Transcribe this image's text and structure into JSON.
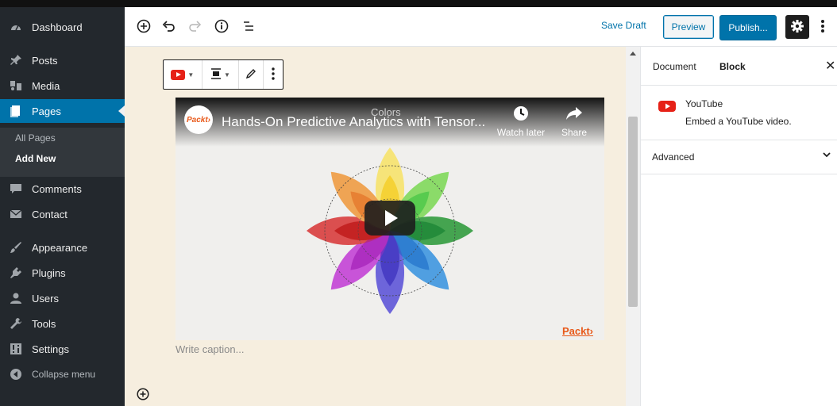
{
  "admin_menu": {
    "items": [
      {
        "label": "Dashboard",
        "icon": "dashboard-icon"
      },
      {
        "label": "Posts",
        "icon": "pin-icon"
      },
      {
        "label": "Media",
        "icon": "media-icon"
      },
      {
        "label": "Pages",
        "icon": "page-icon",
        "active": true
      },
      {
        "label": "Comments",
        "icon": "comment-icon"
      },
      {
        "label": "Contact",
        "icon": "mail-icon"
      },
      {
        "label": "Appearance",
        "icon": "brush-icon"
      },
      {
        "label": "Plugins",
        "icon": "plug-icon"
      },
      {
        "label": "Users",
        "icon": "users-icon"
      },
      {
        "label": "Tools",
        "icon": "wrench-icon"
      },
      {
        "label": "Settings",
        "icon": "settings-icon"
      }
    ],
    "submenu": [
      "All Pages",
      "Add New"
    ],
    "collapse_label": "Collapse menu"
  },
  "toolbar": {
    "save_draft": "Save Draft",
    "preview": "Preview",
    "publish": "Publish..."
  },
  "block_toolbar": {
    "icons": [
      "youtube-icon",
      "align-center-icon",
      "edit-pencil-icon",
      "more-vertical-icon"
    ]
  },
  "video": {
    "channel_logo": "Packt›",
    "title": "Hands-On Predictive Analytics with Tensor...",
    "watch_later": "Watch later",
    "share": "Share",
    "overlay_label": "Colors",
    "watermark": "Packt›"
  },
  "caption_placeholder": "Write caption...",
  "settings_panel": {
    "tabs": [
      "Document",
      "Block"
    ],
    "active_tab": "Block",
    "block_title": "YouTube",
    "block_description": "Embed a YouTube video.",
    "advanced_label": "Advanced"
  },
  "colors": {
    "admin_bg": "#23282d",
    "accent": "#0073aa",
    "canvas_bg": "#f6eedf",
    "youtube_red": "#e62117",
    "packt_orange": "#e8591a"
  }
}
